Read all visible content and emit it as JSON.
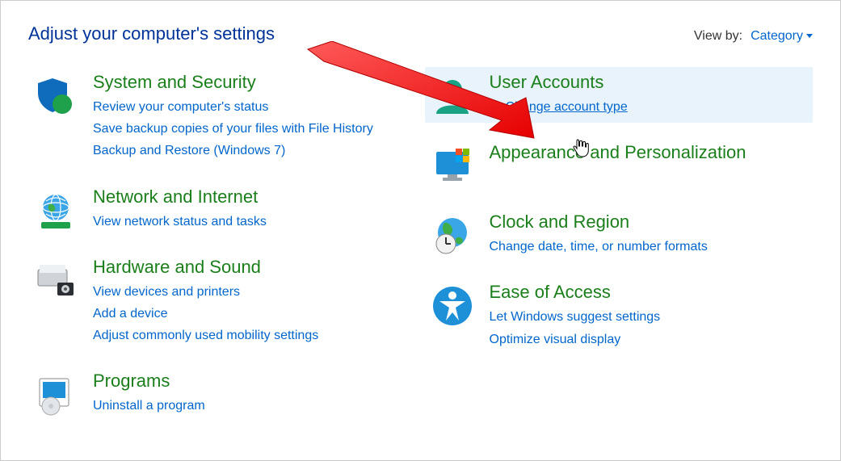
{
  "header": {
    "title": "Adjust your computer's settings",
    "viewby_label": "View by:",
    "viewby_value": "Category"
  },
  "left": [
    {
      "id": "system-security",
      "title": "System and Security",
      "links": [
        "Review your computer's status",
        "Save backup copies of your files with File History",
        "Backup and Restore (Windows 7)"
      ]
    },
    {
      "id": "network-internet",
      "title": "Network and Internet",
      "links": [
        "View network status and tasks"
      ]
    },
    {
      "id": "hardware-sound",
      "title": "Hardware and Sound",
      "links": [
        "View devices and printers",
        "Add a device",
        "Adjust commonly used mobility settings"
      ]
    },
    {
      "id": "programs",
      "title": "Programs",
      "links": [
        "Uninstall a program"
      ]
    }
  ],
  "right": [
    {
      "id": "user-accounts",
      "title": "User Accounts",
      "hovered": true,
      "links": [
        {
          "text": "Change account type",
          "shield": true,
          "underlined": true
        }
      ]
    },
    {
      "id": "appearance",
      "title": "Appearance and Personalization",
      "links": []
    },
    {
      "id": "clock-region",
      "title": "Clock and Region",
      "links": [
        "Change date, time, or number formats"
      ]
    },
    {
      "id": "ease-of-access",
      "title": "Ease of Access",
      "links": [
        "Let Windows suggest settings",
        "Optimize visual display"
      ]
    }
  ]
}
